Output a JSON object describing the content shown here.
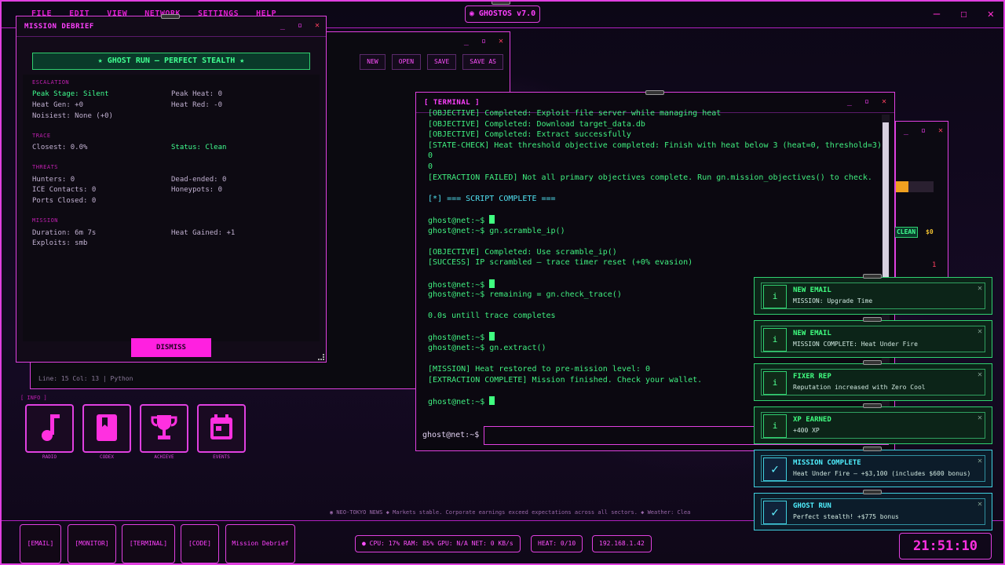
{
  "menubar": {
    "items": [
      "FILE",
      "EDIT",
      "VIEW",
      "NETWORK",
      "SETTINGS",
      "HELP"
    ],
    "logo": "◉ GHOSTOS v7.0"
  },
  "editor": {
    "toolbar": [
      "NEW",
      "OPEN",
      "SAVE",
      "SAVE AS"
    ],
    "status": "Line: 15  Col: 13  |  Python"
  },
  "debrief": {
    "title": "MISSION DEBRIEF",
    "banner": "★ GHOST RUN — PERFECT STEALTH ★",
    "sections": {
      "escalation": "ESCALATION",
      "trace": "TRACE",
      "threats": "THREATS",
      "mission": "MISSION"
    },
    "peak_stage": "Peak Stage: Silent",
    "peak_heat": "Peak Heat: 0",
    "heat_gen": "Heat Gen: +0",
    "heat_red": "Heat Red: -0",
    "noisiest": "Noisiest: None (+0)",
    "closest": "Closest: 0.0%",
    "status": "Status: Clean",
    "hunters": "Hunters: 0",
    "dead_ended": "Dead-ended: 0",
    "ice": "ICE Contacts: 0",
    "honeypots": "Honeypots: 0",
    "ports": "Ports Closed: 0",
    "duration": "Duration: 6m 7s",
    "heat_gained": "Heat Gained: +1",
    "exploits": "Exploits: smb",
    "dismiss": "DISMISS"
  },
  "terminal": {
    "title": "[ TERMINAL ]",
    "lines": [
      {
        "t": "[OBJECTIVE] Completed: Exploit file server while managing heat",
        "c": ""
      },
      {
        "t": "[OBJECTIVE] Completed: Download target_data.db",
        "c": ""
      },
      {
        "t": "[OBJECTIVE] Completed: Extract successfully",
        "c": ""
      },
      {
        "t": "[STATE-CHECK] Heat threshold objective completed: Finish with heat below 3 (heat=0, threshold=3)",
        "c": ""
      },
      {
        "t": "0",
        "c": ""
      },
      {
        "t": "0",
        "c": ""
      },
      {
        "t": "[EXTRACTION FAILED] Not all primary objectives complete. Run gn.mission_objectives() to check.",
        "c": ""
      },
      {
        "t": "",
        "c": ""
      },
      {
        "t": "[*] === SCRIPT COMPLETE ===",
        "c": "cyan"
      },
      {
        "t": "",
        "c": ""
      },
      {
        "t": "ghost@net:~$ ",
        "c": "",
        "cursor": true
      },
      {
        "t": "ghost@net:~$ gn.scramble_ip()",
        "c": ""
      },
      {
        "t": "",
        "c": ""
      },
      {
        "t": "[OBJECTIVE] Completed: Use scramble_ip()",
        "c": ""
      },
      {
        "t": "[SUCCESS] IP scrambled — trace timer reset (+0% evasion)",
        "c": ""
      },
      {
        "t": "",
        "c": ""
      },
      {
        "t": "ghost@net:~$ ",
        "c": "",
        "cursor": true
      },
      {
        "t": "ghost@net:~$ remaining = gn.check_trace()",
        "c": ""
      },
      {
        "t": "",
        "c": ""
      },
      {
        "t": "0.0s untill trace completes",
        "c": ""
      },
      {
        "t": "",
        "c": ""
      },
      {
        "t": "ghost@net:~$ ",
        "c": "",
        "cursor": true
      },
      {
        "t": "ghost@net:~$ gn.extract()",
        "c": ""
      },
      {
        "t": "",
        "c": ""
      },
      {
        "t": "[MISSION] Heat restored to pre-mission level: 0",
        "c": ""
      },
      {
        "t": "[EXTRACTION COMPLETE] Mission finished. Check your wallet.",
        "c": ""
      },
      {
        "t": "",
        "c": ""
      },
      {
        "t": "ghost@net:~$ ",
        "c": "",
        "cursor": true
      }
    ],
    "prompt": "ghost@net:~$"
  },
  "desktop": {
    "info": "[ INFO ]",
    "icons": [
      {
        "label": "RADIO",
        "icon": "music-note-icon"
      },
      {
        "label": "CODEX",
        "icon": "book-icon"
      },
      {
        "label": "ACHIEVE",
        "icon": "trophy-icon"
      },
      {
        "label": "EVENTS",
        "icon": "calendar-icon"
      }
    ]
  },
  "ticker": "◉ NEO-TOKYO NEWS  ◆  Markets stable. Corporate earnings exceed expectations across all sectors.  ◆  Weather: Clea",
  "taskbar": {
    "buttons": [
      "[EMAIL]",
      "[MONITOR]",
      "[TERMINAL]",
      "[CODE]",
      "Mission Debrief"
    ],
    "sys": "● CPU: 17%  RAM: 85%  GPU: N/A  NET: 0 KB/s",
    "heat": "HEAT: 0/10",
    "ip": "192.168.1.42",
    "clock": "21:51:10"
  },
  "rightwin": {
    "clean": "CLEAN",
    "money": "$0",
    "count": "1"
  },
  "notifications": [
    {
      "title": "NEW EMAIL",
      "body": "MISSION: Upgrade Time",
      "icon": "i",
      "kind": "green"
    },
    {
      "title": "NEW EMAIL",
      "body": "MISSION COMPLETE: Heat Under Fire",
      "icon": "i",
      "kind": "green"
    },
    {
      "title": "FIXER REP",
      "body": "Reputation increased with Zero Cool",
      "icon": "i",
      "kind": "green"
    },
    {
      "title": "XP EARNED",
      "body": "+400 XP",
      "icon": "i",
      "kind": "green"
    },
    {
      "title": "MISSION COMPLETE",
      "body": "Heat Under Fire — +$3,100 (includes $600 bonus)",
      "icon": "✓",
      "kind": "cyan"
    },
    {
      "title": "GHOST RUN",
      "body": "Perfect stealth! +$775 bonus",
      "icon": "✓",
      "kind": "cyan"
    }
  ],
  "colors": {
    "accent": "#e040e0",
    "success": "#40ff80",
    "info": "#50f0ff"
  }
}
